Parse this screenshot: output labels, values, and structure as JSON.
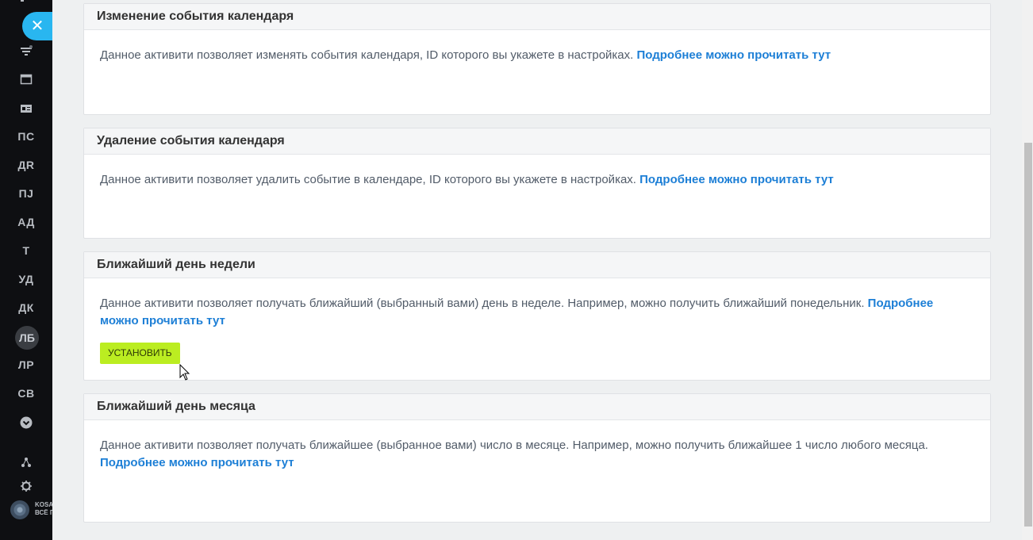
{
  "sidebar": {
    "close_icon": "close-icon",
    "items": [
      {
        "label": "ПС"
      },
      {
        "label": "ДR"
      },
      {
        "label": "ПJ"
      },
      {
        "label": "АД"
      },
      {
        "label": "Т"
      },
      {
        "label": "УД"
      },
      {
        "label": "ДК"
      },
      {
        "label": "ЛБ"
      },
      {
        "label": "ЛР"
      },
      {
        "label": "СВ"
      }
    ],
    "logo_text_line1": "KOSA",
    "logo_text_line2": "ВСЁ П"
  },
  "cards": [
    {
      "title": "Изменение события календаря",
      "text": "Данное активити позволяет изменять события календаря, ID которого вы укажете в настройках.",
      "link": "Подробнее можно прочитать тут"
    },
    {
      "title": "Удаление события календаря",
      "text": "Данное активити позволяет удалить событие в календаре, ID которого вы укажете в настройках.",
      "link": "Подробнее можно прочитать тут"
    },
    {
      "title": "Ближайший день недели",
      "text": "Данное активити позволяет получать ближайший (выбранный вами) день в неделе. Например, можно получить ближайший понедельник.",
      "link": "Подробнее можно прочитать тут",
      "button": "УСТАНОВИТЬ"
    },
    {
      "title": "Ближайший день месяца",
      "text": "Данное активити позволяет получать ближайшее (выбранное вами) число в месяце. Например, можно получить ближайшее 1 число любого месяца.",
      "link": "Подробнее можно прочитать тут"
    }
  ],
  "colors": {
    "accent_link": "#1d7fd6",
    "install_button": "#bbed21",
    "sidebar_bg": "#0e0f12",
    "close_button": "#29b6f0"
  }
}
